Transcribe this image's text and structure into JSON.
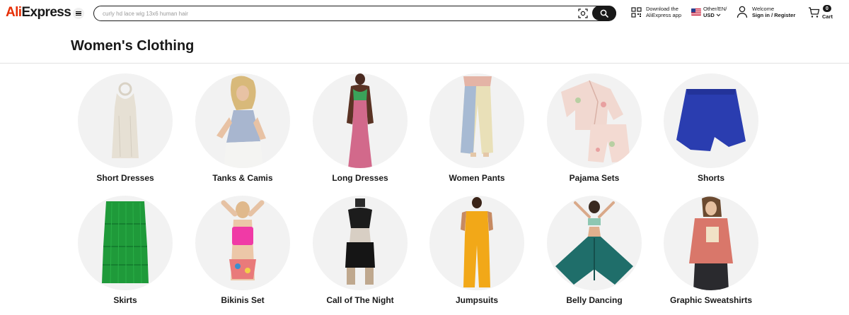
{
  "header": {
    "logo_prefix": "Ali",
    "logo_suffix": "Express",
    "search_placeholder": "curly hd lace wig 13x6 human hair",
    "app_line1": "Download the",
    "app_line2": "AliExpress app",
    "lang_line1": "Other/EN/",
    "lang_line2": "USD",
    "account_line1": "Welcome",
    "account_line2": "Sign in / Register",
    "cart_count": "0",
    "cart_label": "Cart",
    "colors": {
      "brand": "#e62e04",
      "text": "#191919"
    }
  },
  "page": {
    "title": "Women's Clothing"
  },
  "categories": [
    {
      "label": "Short Dresses",
      "icon": "short-dress"
    },
    {
      "label": "Tanks & Camis",
      "icon": "tank-cami"
    },
    {
      "label": "Long Dresses",
      "icon": "long-dress"
    },
    {
      "label": "Women Pants",
      "icon": "pants"
    },
    {
      "label": "Pajama Sets",
      "icon": "pajama-set"
    },
    {
      "label": "Shorts",
      "icon": "shorts"
    },
    {
      "label": "Skirts",
      "icon": "skirt"
    },
    {
      "label": "Bikinis Set",
      "icon": "bikini"
    },
    {
      "label": "Call of The Night",
      "icon": "night-outfit"
    },
    {
      "label": "Jumpsuits",
      "icon": "jumpsuit"
    },
    {
      "label": "Belly Dancing",
      "icon": "belly-dance"
    },
    {
      "label": "Graphic Sweatshirts",
      "icon": "sweatshirt"
    }
  ]
}
